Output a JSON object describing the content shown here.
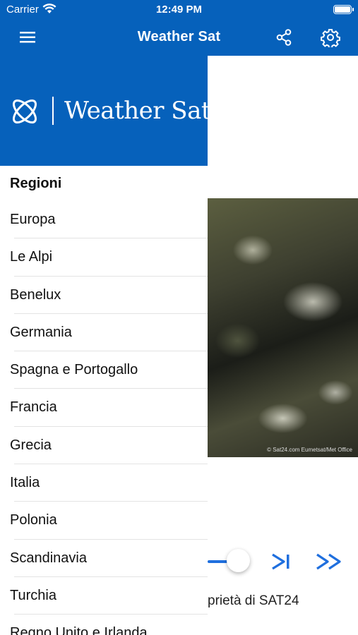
{
  "status_bar": {
    "carrier": "Carrier",
    "time": "12:49 PM"
  },
  "nav": {
    "title": "Weather Sat"
  },
  "drawer": {
    "logo_text": "Weather Sat",
    "section_title": "Regioni",
    "regions": [
      "Europa",
      "Le Alpi",
      "Benelux",
      "Germania",
      "Spagna e Portogallo",
      "Francia",
      "Grecia",
      "Italia",
      "Polonia",
      "Scandinavia",
      "Turchia",
      "Regno Unito e Irlanda"
    ]
  },
  "content": {
    "image_credit": "© Sat24.com Eumetsat/Met Office",
    "footer_text": "prietà di SAT24"
  },
  "colors": {
    "brand": "#0661bb",
    "accent": "#1f6fde"
  },
  "icons": {
    "menu": "hamburger-menu-icon",
    "share": "share-icon",
    "settings": "gear-icon",
    "next": "skip-next-icon",
    "fast_forward": "fast-forward-icon"
  }
}
